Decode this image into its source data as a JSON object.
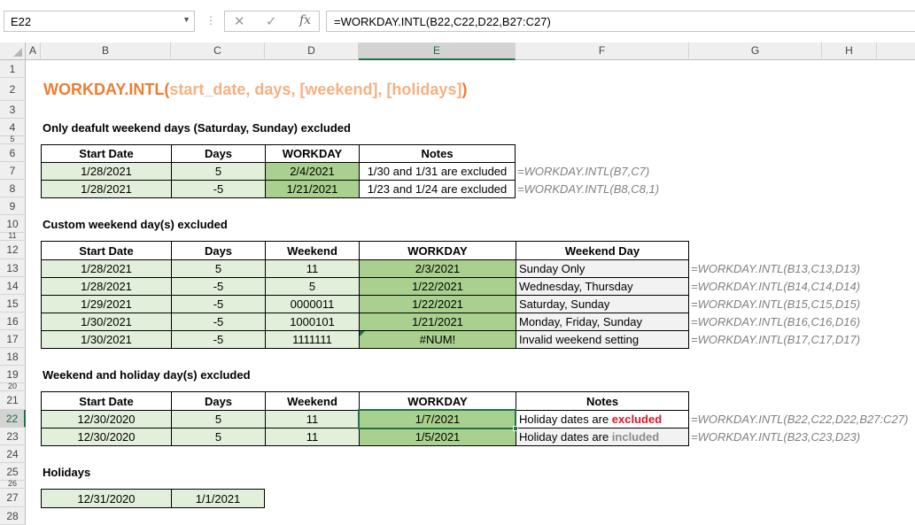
{
  "name_box": "E22",
  "formula_bar": {
    "cancel_icon": "✕",
    "enter_icon": "✓",
    "fx_label": "fx",
    "formula": "=WORKDAY.INTL(B22,C22,D22,B27:C27)"
  },
  "columns": [
    "A",
    "B",
    "C",
    "D",
    "E",
    "F",
    "G",
    "H"
  ],
  "rows": [
    "1",
    "2",
    "3",
    "4",
    "5",
    "6",
    "7",
    "8",
    "9",
    "10",
    "11",
    "12",
    "13",
    "14",
    "15",
    "16",
    "17",
    "18",
    "19",
    "20",
    "21",
    "22",
    "23",
    "24",
    "25",
    "26",
    "27",
    "28"
  ],
  "title": {
    "func": "WORKDAY.INTL(",
    "args": "start_date, days, [weekend], [holidays]",
    "close": ")"
  },
  "section1": {
    "label": "Only deafult weekend days (Saturday, Sunday) excluded",
    "headers": [
      "Start Date",
      "Days",
      "WORKDAY",
      "Notes"
    ],
    "rows": [
      {
        "start": "1/28/2021",
        "days": "5",
        "workday": "2/4/2021",
        "notes": "1/30 and 1/31 are excluded",
        "formula": "=WORKDAY.INTL(B7,C7)"
      },
      {
        "start": "1/28/2021",
        "days": "-5",
        "workday": "1/21/2021",
        "notes": "1/23 and 1/24 are excluded",
        "formula": "=WORKDAY.INTL(B8,C8,1)"
      }
    ]
  },
  "section2": {
    "label": "Custom weekend day(s) excluded",
    "headers": [
      "Start Date",
      "Days",
      "Weekend",
      "WORKDAY",
      "Weekend Day"
    ],
    "rows": [
      {
        "start": "1/28/2021",
        "days": "5",
        "weekend": "11",
        "workday": "2/3/2021",
        "day": "Sunday Only",
        "formula": "=WORKDAY.INTL(B13,C13,D13)"
      },
      {
        "start": "1/28/2021",
        "days": "-5",
        "weekend": "5",
        "workday": "1/22/2021",
        "day": "Wednesday, Thursday",
        "formula": "=WORKDAY.INTL(B14,C14,D14)"
      },
      {
        "start": "1/29/2021",
        "days": "-5",
        "weekend": "0000011",
        "workday": "1/22/2021",
        "day": "Saturday, Sunday",
        "formula": "=WORKDAY.INTL(B15,C15,D15)"
      },
      {
        "start": "1/30/2021",
        "days": "-5",
        "weekend": "1000101",
        "workday": "1/21/2021",
        "day": "Monday, Friday, Sunday",
        "formula": "=WORKDAY.INTL(B16,C16,D16)"
      },
      {
        "start": "1/30/2021",
        "days": "-5",
        "weekend": "1111111",
        "workday": "#NUM!",
        "day": "Invalid weekend setting",
        "formula": "=WORKDAY.INTL(B17,C17,D17)"
      }
    ]
  },
  "section3": {
    "label": "Weekend and holiday day(s) excluded",
    "headers": [
      "Start Date",
      "Days",
      "Weekend",
      "WORKDAY",
      "Notes"
    ],
    "rows": [
      {
        "start": "12/30/2020",
        "days": "5",
        "weekend": "11",
        "workday": "1/7/2021",
        "notes_prefix": "Holiday dates are ",
        "notes_em": "excluded",
        "formula": "=WORKDAY.INTL(B22,C22,D22,B27:C27)"
      },
      {
        "start": "12/30/2020",
        "days": "5",
        "weekend": "11",
        "workday": "1/5/2021",
        "notes_prefix": "Holiday dates are ",
        "notes_em": "included",
        "formula": "=WORKDAY.INTL(B23,C23,D23)"
      }
    ]
  },
  "holidays": {
    "label": "Holidays",
    "dates": [
      "12/31/2020",
      "1/1/2021"
    ]
  },
  "colors": {
    "accent_title": "#ed7d31",
    "args_title": "#f4b183",
    "light_green": "#e2efda",
    "dark_green": "#a9d08e",
    "selection": "#217346",
    "red_text": "#e81123"
  }
}
